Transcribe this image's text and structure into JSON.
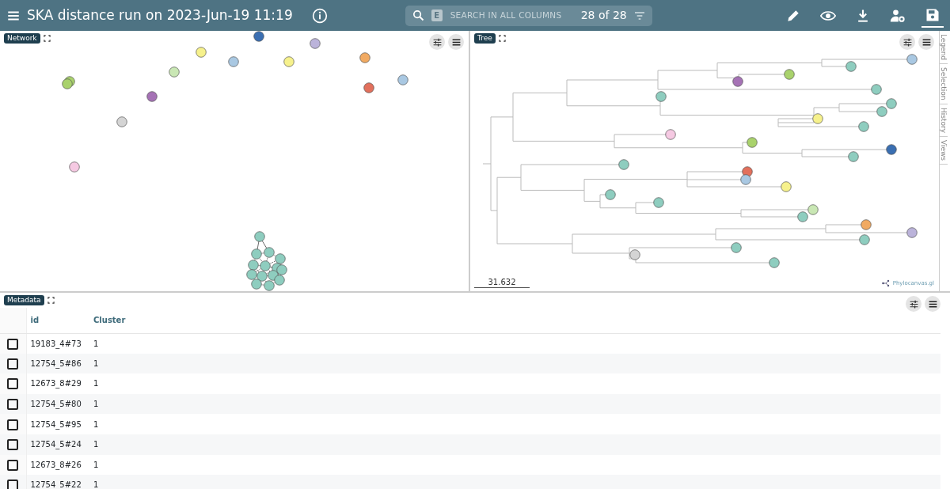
{
  "header": {
    "title": "SKA distance run on 2023-Jun-19 11:19",
    "search": {
      "key": "E",
      "placeholder": "SEARCH IN ALL COLUMNS",
      "count": "28 of 28"
    },
    "toolbar": [
      {
        "kind": "edit",
        "selected": false
      },
      {
        "kind": "view",
        "selected": false
      },
      {
        "kind": "download",
        "selected": false
      },
      {
        "kind": "account",
        "selected": false
      },
      {
        "kind": "save",
        "selected": true
      }
    ]
  },
  "panels": [
    {
      "kind": "network",
      "label": "Network"
    },
    {
      "kind": "tree",
      "label": "Tree",
      "scale": "31.632",
      "logo": "Phylocanvas.gl"
    }
  ],
  "side_tabs": [
    "Legend",
    "Selection",
    "History",
    "Views"
  ],
  "metadata": {
    "label": "Metadata",
    "columns": [
      "id",
      "Cluster"
    ],
    "rows": [
      {
        "id": "19183_4#73",
        "cluster": "1",
        "checked": false
      },
      {
        "id": "12754_5#86",
        "cluster": "1",
        "checked": false
      },
      {
        "id": "12673_8#29",
        "cluster": "1",
        "checked": false
      },
      {
        "id": "12754_5#80",
        "cluster": "1",
        "checked": false
      },
      {
        "id": "12754_5#95",
        "cluster": "1",
        "checked": false
      },
      {
        "id": "12754_5#24",
        "cluster": "1",
        "checked": false
      },
      {
        "id": "12673_8#26",
        "cluster": "1",
        "checked": false
      },
      {
        "id": "12754_5#22",
        "cluster": "1",
        "checked": false
      }
    ]
  }
}
